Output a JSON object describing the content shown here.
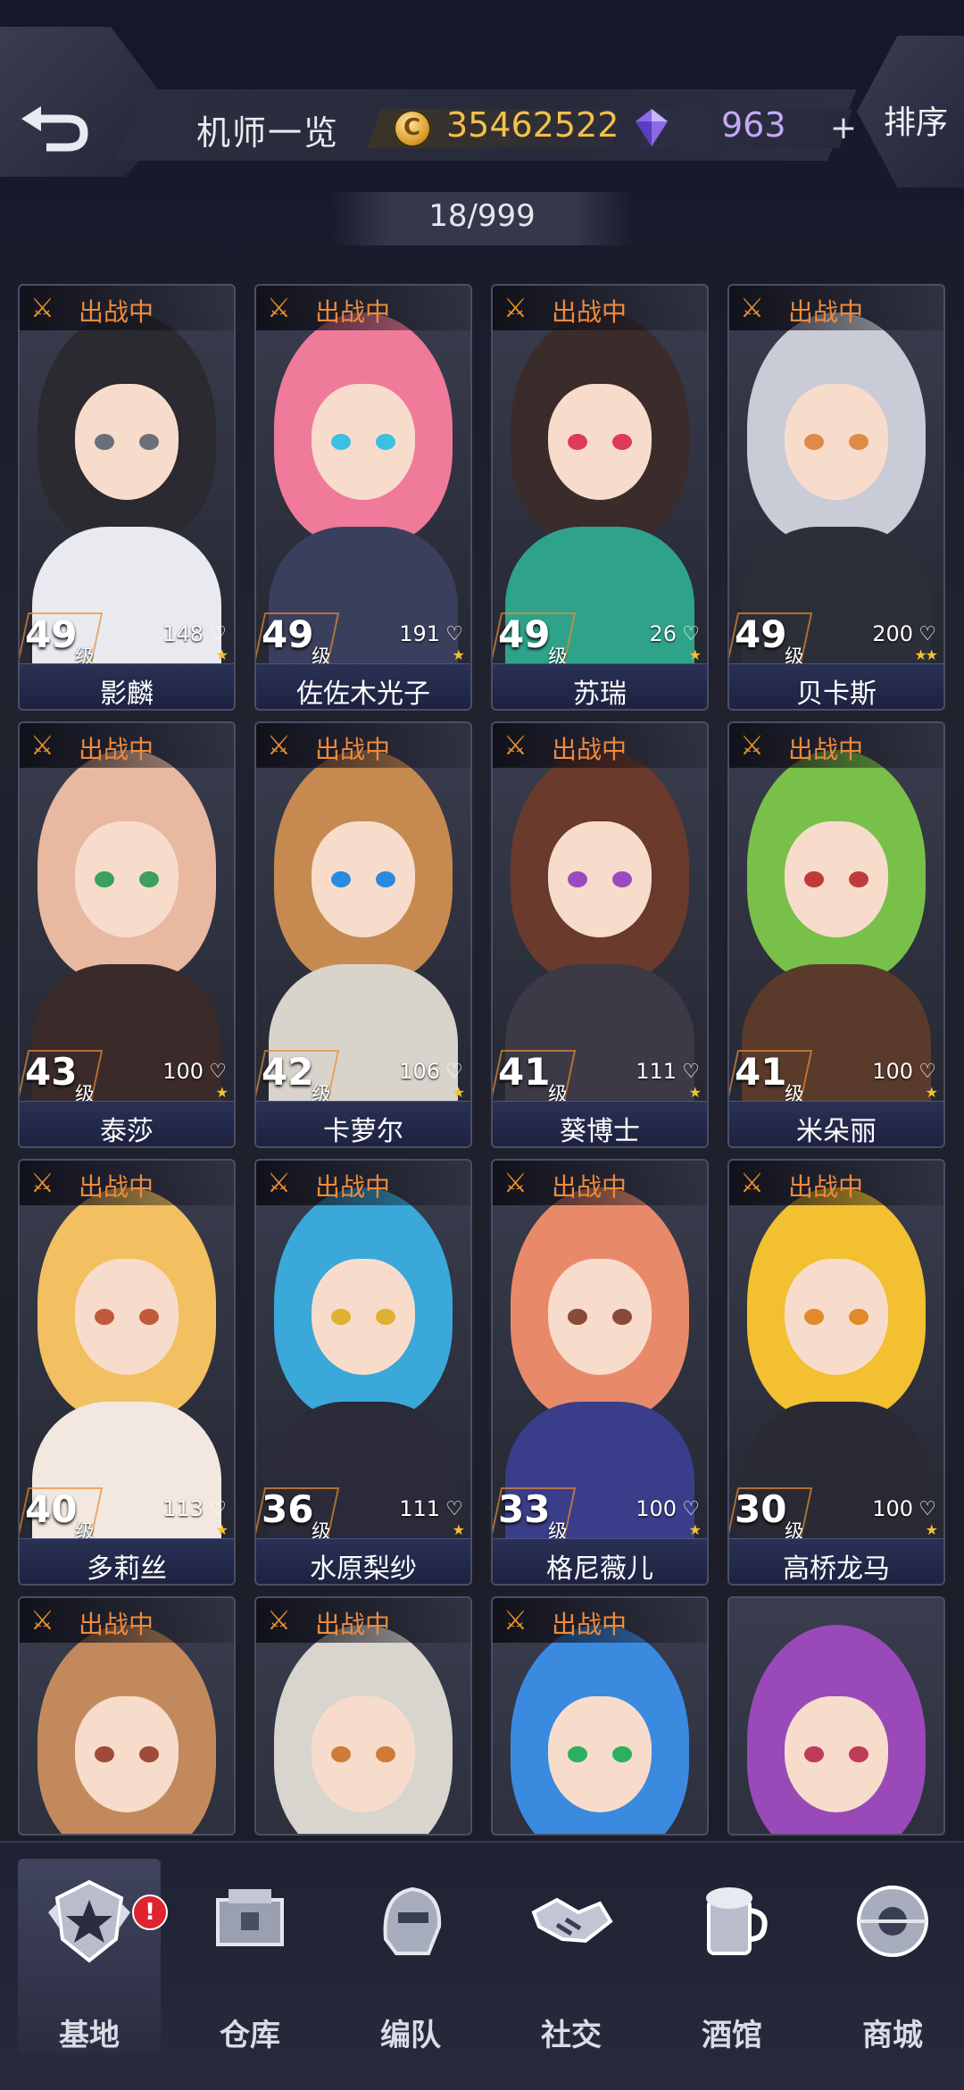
{
  "header": {
    "back_icon": "back-arrow-icon",
    "title": "机师一览",
    "gold": "35462522",
    "gems": "963",
    "plus": "+",
    "sort": "排序",
    "count": "18/999"
  },
  "pilots": [
    {
      "name": "影麟",
      "level": "49",
      "unit": "级",
      "affinity": "148",
      "stars": "★",
      "status": "出战中",
      "hair": "#2a2a30",
      "body": "#e9eaf0",
      "eye": "#6a6f7a"
    },
    {
      "name": "佐佐木光子",
      "level": "49",
      "unit": "级",
      "affinity": "191",
      "stars": "★",
      "status": "出战中",
      "hair": "#f07a9a",
      "body": "#3a3f5e",
      "eye": "#3cc0e0"
    },
    {
      "name": "苏瑞",
      "level": "49",
      "unit": "级",
      "affinity": "26",
      "stars": "★",
      "status": "出战中",
      "hair": "#3b2c2c",
      "body": "#2fa38a",
      "eye": "#e03a5a"
    },
    {
      "name": "贝卡斯",
      "level": "49",
      "unit": "级",
      "affinity": "200",
      "stars": "★★",
      "status": "出战中",
      "hair": "#c9ccd6",
      "body": "#2d2f38",
      "eye": "#e08a4a"
    },
    {
      "name": "泰莎",
      "level": "43",
      "unit": "级",
      "affinity": "100",
      "stars": "★",
      "status": "出战中",
      "hair": "#e8b8a0",
      "body": "#3a2a2a",
      "eye": "#3aa060"
    },
    {
      "name": "卡萝尔",
      "level": "42",
      "unit": "级",
      "affinity": "106",
      "stars": "★",
      "status": "出战中",
      "hair": "#c68a50",
      "body": "#d8d4cc",
      "eye": "#2a8ae0"
    },
    {
      "name": "葵博士",
      "level": "41",
      "unit": "级",
      "affinity": "111",
      "stars": "★",
      "status": "出战中",
      "hair": "#6a3a2c",
      "body": "#3c3a46",
      "eye": "#9a4ac0"
    },
    {
      "name": "米朵丽",
      "level": "41",
      "unit": "级",
      "affinity": "100",
      "stars": "★",
      "status": "出战中",
      "hair": "#78c04a",
      "body": "#5a3a2a",
      "eye": "#c03a3a"
    },
    {
      "name": "多莉丝",
      "level": "40",
      "unit": "级",
      "affinity": "113",
      "stars": "★",
      "status": "出战中",
      "hair": "#f2c060",
      "body": "#f2e8e0",
      "eye": "#c05a3a"
    },
    {
      "name": "水原梨纱",
      "level": "36",
      "unit": "级",
      "affinity": "111",
      "stars": "★",
      "status": "出战中",
      "hair": "#3aa8d8",
      "body": "#2a2a38",
      "eye": "#e0b030"
    },
    {
      "name": "格尼薇儿",
      "level": "33",
      "unit": "级",
      "affinity": "100",
      "stars": "★",
      "status": "出战中",
      "hair": "#e88a6a",
      "body": "#3a3e8a",
      "eye": "#8a4a3a"
    },
    {
      "name": "高桥龙马",
      "level": "30",
      "unit": "级",
      "affinity": "100",
      "stars": "★",
      "status": "出战中",
      "hair": "#f2c030",
      "body": "#2a2a34",
      "eye": "#e08a2a"
    },
    {
      "name": "",
      "level": "",
      "unit": "",
      "affinity": "",
      "stars": "",
      "status": "出战中",
      "hair": "#c28a5c",
      "body": "#f2e6dc",
      "eye": "#a04a3a"
    },
    {
      "name": "",
      "level": "",
      "unit": "",
      "affinity": "",
      "stars": "",
      "status": "出战中",
      "hair": "#d8d4ce",
      "body": "#b08a4a",
      "eye": "#d07a3a"
    },
    {
      "name": "",
      "level": "",
      "unit": "",
      "affinity": "",
      "stars": "",
      "status": "出战中",
      "hair": "#3a8ae0",
      "body": "#2a2a34",
      "eye": "#2ab060"
    },
    {
      "name": "",
      "level": "",
      "unit": "",
      "affinity": "",
      "stars": "",
      "status": "",
      "hair": "#9a4ab8",
      "body": "#2a2a30",
      "eye": "#c03a5a"
    }
  ],
  "nav": [
    {
      "label": "基地",
      "icon": "base-star-shield-icon",
      "active": true,
      "badge": "!"
    },
    {
      "label": "仓库",
      "icon": "warehouse-crate-icon"
    },
    {
      "label": "编队",
      "icon": "formation-helmet-icon"
    },
    {
      "label": "社交",
      "icon": "handshake-icon"
    },
    {
      "label": "酒馆",
      "icon": "tavern-mug-icon"
    },
    {
      "label": "商城",
      "icon": "shop-orb-icon"
    }
  ]
}
